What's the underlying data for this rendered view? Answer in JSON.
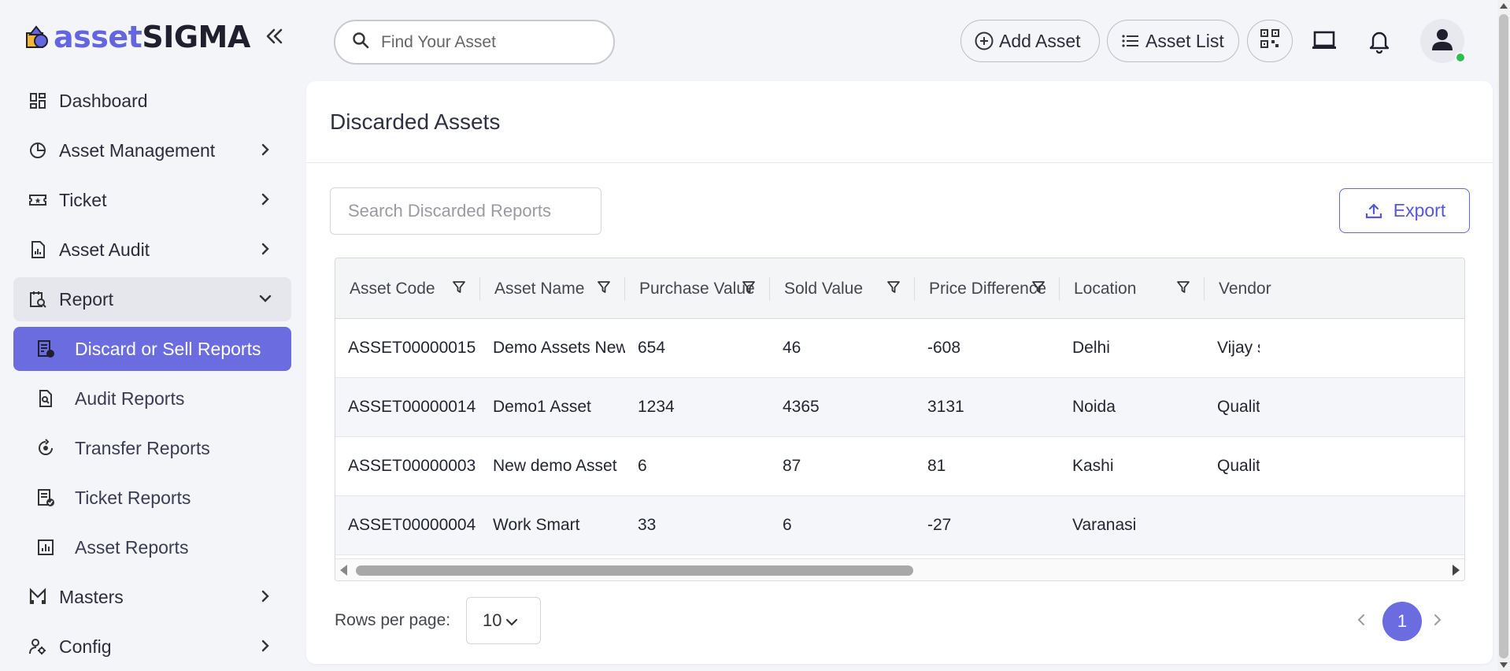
{
  "brand": {
    "logo_part1": "asset",
    "logo_part2": "SIGMA"
  },
  "sidebar": {
    "items": [
      {
        "label": "Dashboard",
        "icon": "dashboard-icon"
      },
      {
        "label": "Asset Management",
        "icon": "pie-chart-icon"
      },
      {
        "label": "Ticket",
        "icon": "ticket-icon"
      },
      {
        "label": "Asset Audit",
        "icon": "audit-chart-icon"
      },
      {
        "label": "Report",
        "icon": "report-search-icon"
      },
      {
        "label": "Masters",
        "icon": "masters-icon"
      },
      {
        "label": "Config",
        "icon": "user-settings-icon"
      }
    ],
    "report_sub": [
      {
        "label": "Discard or Sell Reports",
        "icon": "discard-report-icon"
      },
      {
        "label": "Audit Reports",
        "icon": "audit-report-icon"
      },
      {
        "label": "Transfer Reports",
        "icon": "transfer-report-icon"
      },
      {
        "label": "Ticket Reports",
        "icon": "ticket-report-icon"
      },
      {
        "label": "Asset Reports",
        "icon": "asset-report-icon"
      }
    ]
  },
  "topbar": {
    "search_placeholder": "Find Your Asset",
    "add_asset_label": "Add Asset",
    "asset_list_label": "Asset List"
  },
  "page": {
    "title": "Discarded Assets",
    "search_placeholder": "Search Discarded Reports",
    "export_label": "Export"
  },
  "table": {
    "columns": [
      "Asset Code",
      "Asset Name",
      "Purchase Value",
      "Sold Value",
      "Price Difference",
      "Location",
      "Vendor"
    ],
    "rows": [
      [
        "ASSET00000015",
        "Demo Assets New",
        "654",
        "46",
        "-608",
        "Delhi",
        "Vijay sa"
      ],
      [
        "ASSET00000014",
        "Demo1 Asset",
        "1234",
        "4365",
        "3131",
        "Noida",
        "Quality"
      ],
      [
        "ASSET00000003",
        "New demo Asset",
        "6",
        "87",
        "81",
        "Kashi",
        "Quality"
      ],
      [
        "ASSET00000004",
        "Work Smart",
        "33",
        "6",
        "-27",
        "Varanasi",
        ""
      ]
    ]
  },
  "pagination": {
    "rows_per_page_label": "Rows per page:",
    "rows_per_page_value": "10",
    "current_page": "1"
  },
  "colors": {
    "accent": "#6b6ce0",
    "online": "#2bbf4e"
  }
}
